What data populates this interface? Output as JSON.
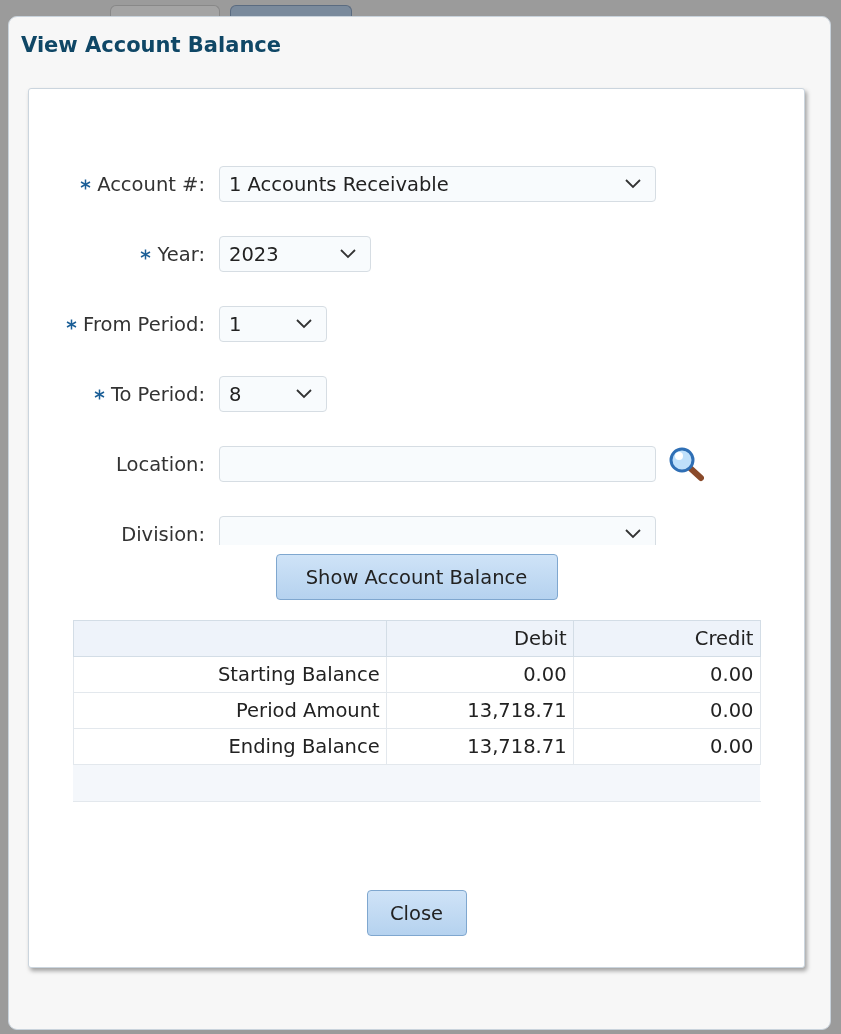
{
  "dialog": {
    "title": "View Account Balance"
  },
  "fields": [
    {
      "label": "Account #:",
      "required": true,
      "kind": "select",
      "value": "1 Accounts Receivable"
    },
    {
      "label": "Year:",
      "required": true,
      "kind": "select",
      "value": "2023"
    },
    {
      "label": "From Period:",
      "required": true,
      "kind": "select",
      "value": "1"
    },
    {
      "label": "To Period:",
      "required": true,
      "kind": "select",
      "value": "8"
    },
    {
      "label": "Location:",
      "required": false,
      "kind": "lookup"
    },
    {
      "label": "Division:",
      "required": false,
      "kind": "select"
    }
  ],
  "action_button": "Show Account Balance",
  "table": {
    "columns": [
      "",
      "Debit",
      "Credit"
    ],
    "rows": [
      [
        "Starting Balance",
        "0.00",
        "0.00"
      ],
      [
        "Period Amount",
        "13,718.71",
        "0.00"
      ],
      [
        "Ending Balance",
        "13,718.71",
        "0.00"
      ]
    ]
  },
  "close_button": "Close"
}
